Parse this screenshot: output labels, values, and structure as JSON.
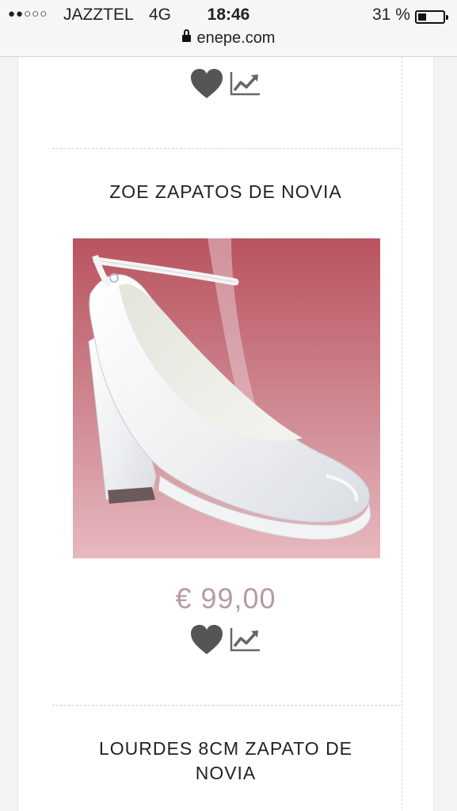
{
  "status_bar": {
    "signal": "●●○○○",
    "carrier": "JAZZTEL",
    "network": "4G",
    "time": "18:46",
    "battery": "31 %",
    "battery_level": 0.31
  },
  "url_bar": {
    "url": "enepe.com"
  },
  "products": [
    {
      "name": "ZOE ZAPATOS DE NOVIA",
      "price": "€ 99,00",
      "image_icon": "white-bridal-shoe-image"
    },
    {
      "name": "LOURDES 8CM ZAPATO DE NOVIA"
    }
  ],
  "icons": {
    "favorite": "heart-icon",
    "compare": "trend-chart-icon"
  },
  "colors": {
    "price": "#b79aa3",
    "icon": "#555555",
    "photo_bg": "#c9707c"
  }
}
